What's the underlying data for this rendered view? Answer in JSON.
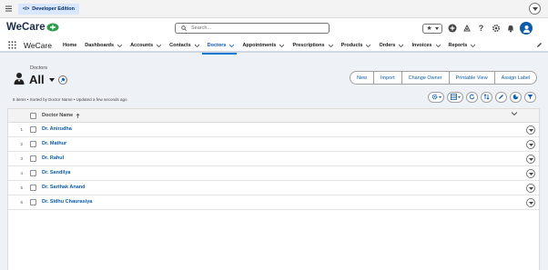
{
  "topbar": {
    "edition_label": "Developer Edition"
  },
  "header": {
    "brand": "WeCare",
    "search_placeholder": "Search..."
  },
  "nav": {
    "app_name": "WeCare",
    "items": [
      {
        "label": "Home",
        "has_menu": false
      },
      {
        "label": "Dashboards",
        "has_menu": true
      },
      {
        "label": "Accounts",
        "has_menu": true
      },
      {
        "label": "Contacts",
        "has_menu": true
      },
      {
        "label": "Doctors",
        "has_menu": true,
        "active": true
      },
      {
        "label": "Appointments",
        "has_menu": true
      },
      {
        "label": "Prescriptions",
        "has_menu": true
      },
      {
        "label": "Products",
        "has_menu": true
      },
      {
        "label": "Orders",
        "has_menu": true
      },
      {
        "label": "Invoices",
        "has_menu": true
      },
      {
        "label": "Reports",
        "has_menu": true
      }
    ]
  },
  "list": {
    "object_label": "Doctors",
    "view_name": "All",
    "buttons": [
      "New",
      "Import",
      "Change Owner",
      "Printable View",
      "Assign Label"
    ],
    "meta": "6 items • Sorted by Doctor Name • Updated a few seconds ago",
    "column_header": "Doctor Name",
    "rows": [
      {
        "num": "1",
        "name": "Dr. Anirudha"
      },
      {
        "num": "2",
        "name": "Dr. Mathur"
      },
      {
        "num": "3",
        "name": "Dr. Rahul"
      },
      {
        "num": "4",
        "name": "Dr. Sandilya"
      },
      {
        "num": "5",
        "name": "Dr. Sarthak Anand"
      },
      {
        "num": "6",
        "name": "Dr. Sidhu Chaurasiya"
      }
    ]
  },
  "colors": {
    "brand_blue": "#0b5cab",
    "accent": "#0176d3",
    "page_bg": "#eef1f6"
  }
}
